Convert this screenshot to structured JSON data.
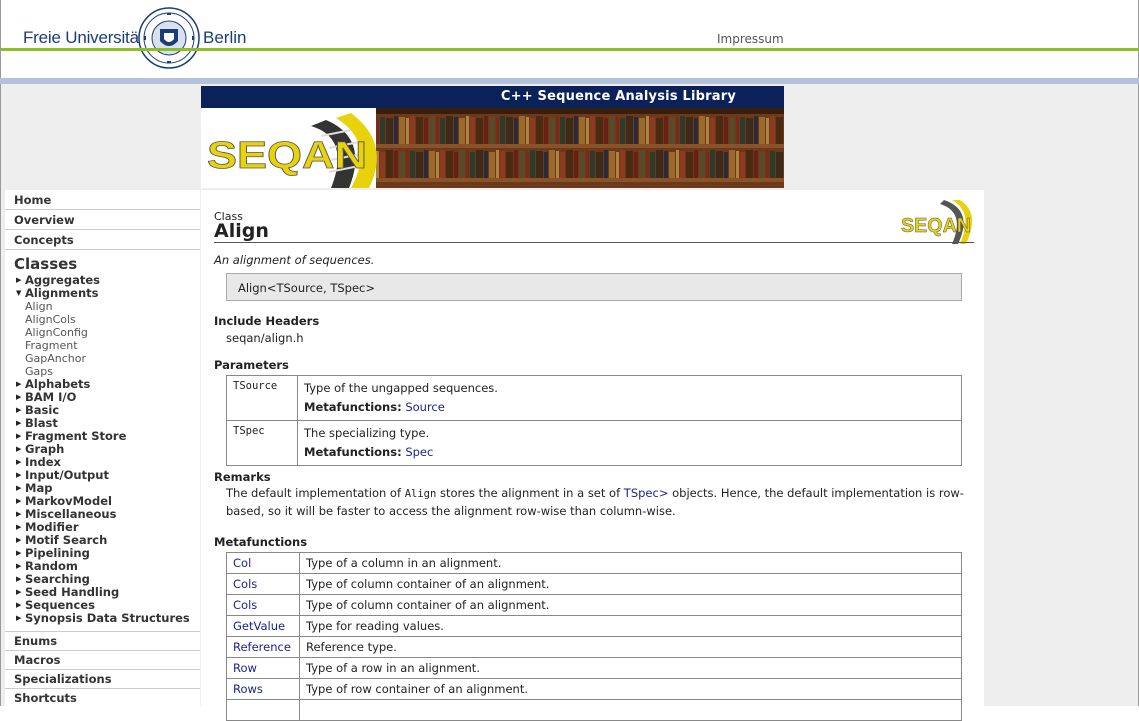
{
  "header": {
    "university_left": "Freie Universität",
    "university_right": "Berlin",
    "impressum": "Impressum"
  },
  "banner": {
    "title": "C++ Sequence Analysis Library",
    "logo_text": "SEQAN"
  },
  "sidebar": {
    "top": [
      "Home",
      "Overview",
      "Concepts"
    ],
    "classes_heading": "Classes",
    "groups": [
      {
        "label": "Aggregates",
        "expanded": false
      },
      {
        "label": "Alignments",
        "expanded": true,
        "children": [
          "Align",
          "AlignCols",
          "AlignConfig",
          "Fragment",
          "GapAnchor",
          "Gaps"
        ]
      },
      {
        "label": "Alphabets",
        "expanded": false
      },
      {
        "label": "BAM I/O",
        "expanded": false
      },
      {
        "label": "Basic",
        "expanded": false
      },
      {
        "label": "Blast",
        "expanded": false
      },
      {
        "label": "Fragment Store",
        "expanded": false
      },
      {
        "label": "Graph",
        "expanded": false
      },
      {
        "label": "Index",
        "expanded": false
      },
      {
        "label": "Input/Output",
        "expanded": false
      },
      {
        "label": "Map",
        "expanded": false
      },
      {
        "label": "MarkovModel",
        "expanded": false
      },
      {
        "label": "Miscellaneous",
        "expanded": false
      },
      {
        "label": "Modifier",
        "expanded": false
      },
      {
        "label": "Motif Search",
        "expanded": false
      },
      {
        "label": "Pipelining",
        "expanded": false
      },
      {
        "label": "Random",
        "expanded": false
      },
      {
        "label": "Searching",
        "expanded": false
      },
      {
        "label": "Seed Handling",
        "expanded": false
      },
      {
        "label": "Sequences",
        "expanded": false
      },
      {
        "label": "Synopsis Data Structures",
        "expanded": false
      }
    ],
    "bottom": [
      "Enums",
      "Macros",
      "Specializations",
      "Shortcuts"
    ]
  },
  "page": {
    "kind": "Class",
    "name": "Align",
    "summary": "An alignment of sequences.",
    "signature": "Align<TSource, TSpec>",
    "include_heading": "Include Headers",
    "include": "seqan/align.h",
    "parameters_heading": "Parameters",
    "parameters": [
      {
        "name": "TSource",
        "desc": "Type of the ungapped sequences.",
        "meta_label": "Metafunctions:",
        "meta": "Source"
      },
      {
        "name": "TSpec",
        "desc": "The specializing type.",
        "meta_label": "Metafunctions:",
        "meta": "Spec"
      }
    ],
    "remarks_heading": "Remarks",
    "remarks": {
      "pre": "The default implementation of ",
      "code": "Align",
      "mid": " stores the alignment in a set of ",
      "link": "TSpec>",
      "post": " objects. Hence, the default implementation is row-based, so it will be faster to access the alignment row-wise than column-wise."
    },
    "metafunctions_heading": "Metafunctions",
    "metafunctions": [
      {
        "name": "Col",
        "desc": "Type of a column in an alignment."
      },
      {
        "name": "Cols",
        "desc": "Type of column container of an alignment."
      },
      {
        "name": "Cols",
        "desc": "Type of column container of an alignment."
      },
      {
        "name": "GetValue",
        "desc": "Type for reading values."
      },
      {
        "name": "Reference",
        "desc": "Reference type."
      },
      {
        "name": "Row",
        "desc": "Type of a row in an alignment."
      },
      {
        "name": "Rows",
        "desc": "Type of row container of an alignment."
      }
    ]
  },
  "colors": {
    "navy": "#0a2259",
    "green_rule": "#8bbf26",
    "blue_band": "#b4c2dc",
    "link": "#1a1f8c",
    "logo_yellow": "#e8d20c"
  }
}
